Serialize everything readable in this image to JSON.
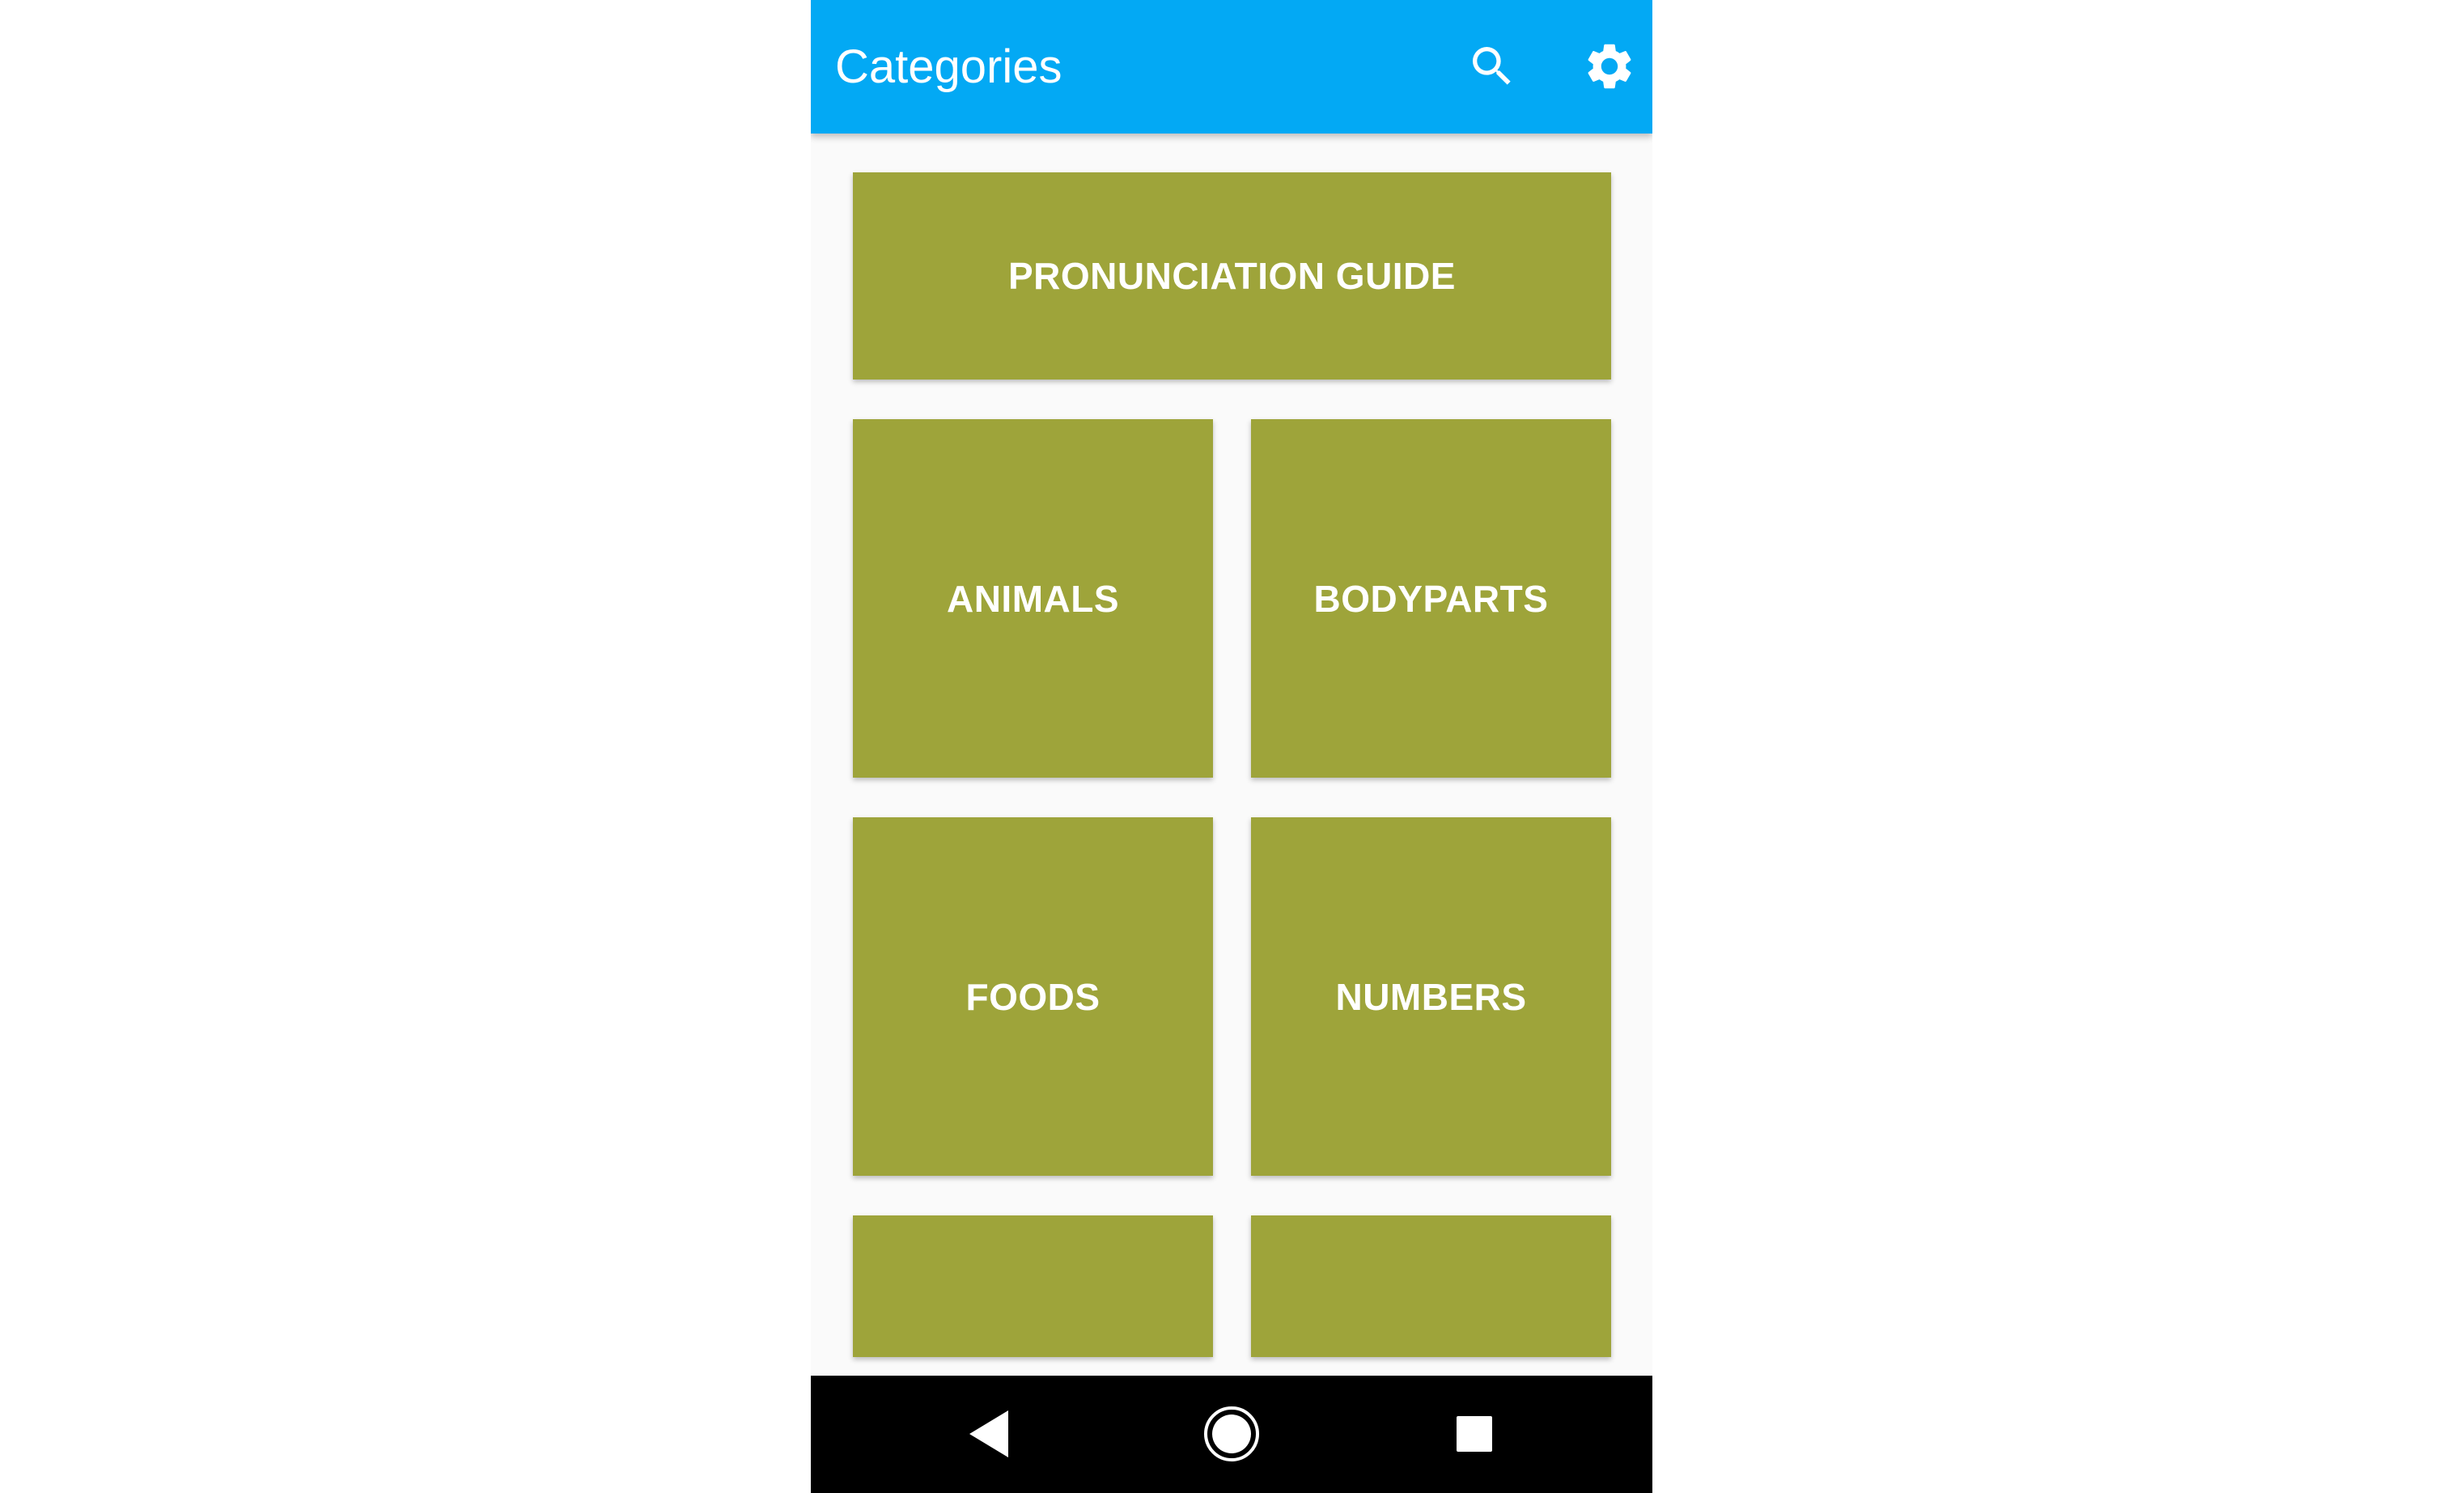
{
  "app_bar": {
    "title": "Categories",
    "background_color": "#03a9f4",
    "actions": [
      {
        "icon": "search-icon"
      },
      {
        "icon": "gear-icon"
      }
    ]
  },
  "categories": {
    "tile_color": "#9ea43a",
    "items": [
      {
        "label": "PRONUNCIATION GUIDE"
      },
      {
        "label": "ANIMALS"
      },
      {
        "label": "BODYPARTS"
      },
      {
        "label": "FOODS"
      },
      {
        "label": "NUMBERS"
      },
      {
        "label": ""
      },
      {
        "label": ""
      }
    ]
  },
  "system_nav": {
    "buttons": [
      {
        "icon": "back-icon"
      },
      {
        "icon": "home-icon"
      },
      {
        "icon": "recents-icon"
      }
    ]
  }
}
